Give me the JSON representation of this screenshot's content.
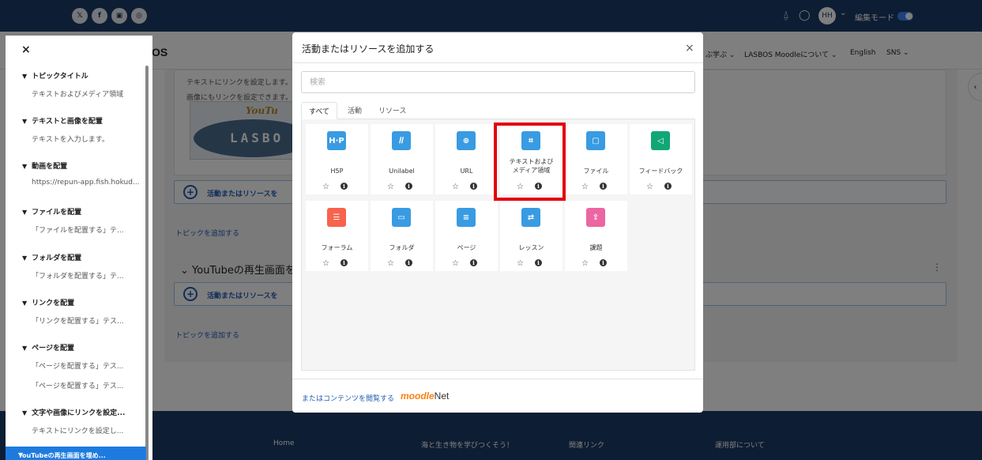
{
  "topbar": {
    "social": [
      "𝕏",
      "f",
      "▣",
      "◎"
    ],
    "avatar_initials": "HH",
    "edit_mode_label": "編集モード",
    "edit_mode_on": true
  },
  "navbar": {
    "logo_fragment": "OS",
    "items": [
      "ぶ学ぶ ⌄",
      "LASBOS Moodleについて ⌄",
      "English",
      "SNS ⌄"
    ]
  },
  "background": {
    "text1": "テキストにリンクを設定します。",
    "text2": "画像にもリンクを設定できます。",
    "youtube_top": "YouTu",
    "youtube_word": "LASBO",
    "add_activity": "活動またはリソースを",
    "add_topic": "トピックを追加する",
    "section_title": "YouTubeの再生画面を",
    "section_chevron": "⌄",
    "kebab": "⋮",
    "right_handle": "‹"
  },
  "footer": {
    "items": [
      "Home",
      "海と生き物を学びつくそう！",
      "関連リンク",
      "運用部について"
    ]
  },
  "drawer": {
    "close": "×",
    "sections": [
      {
        "title": "トピックタイトル",
        "items": [
          "テキストおよびメディア領域"
        ]
      },
      {
        "title": "テキストと画像を配置",
        "items": [
          "テキストを入力します。"
        ]
      },
      {
        "title": "動画を配置",
        "items": [
          "https://repun-app.fish.hokud..."
        ]
      },
      {
        "title": "ファイルを配置",
        "items": [
          "「ファイルを配置する」テ..."
        ]
      },
      {
        "title": "フォルダを配置",
        "items": [
          "「フォルダを配置する」テ..."
        ]
      },
      {
        "title": "リンクを配置",
        "items": [
          "「リンクを配置する」テス..."
        ]
      },
      {
        "title": "ページを配置",
        "items": [
          "「ページを配置する」テス...",
          "「ページを配置する」テス..."
        ]
      },
      {
        "title": "文字や画像にリンクを設定...",
        "items": [
          "テキストにリンクを設定し..."
        ]
      }
    ],
    "active": "YouTubeの再生画面を埋め..."
  },
  "modal": {
    "title": "活動またはリソースを追加する",
    "close": "×",
    "search_placeholder": "検索",
    "tabs": [
      "すべて",
      "活動",
      "リソース"
    ],
    "active_tab": "すべて",
    "tiles": [
      {
        "name": "H5P",
        "icon": "h5p-icon",
        "glyph": "H·P",
        "color": "#399be2"
      },
      {
        "name": "Unilabel",
        "icon": "unilabel-icon",
        "glyph": "𝐼𝐼",
        "color": "#399be2"
      },
      {
        "name": "URL",
        "icon": "globe-icon",
        "glyph": "⊕",
        "color": "#399be2"
      },
      {
        "name": "テキストおよび\nメディア領域",
        "icon": "text-media-icon",
        "glyph": "⌗",
        "color": "#399be2"
      },
      {
        "name": "ファイル",
        "icon": "file-icon",
        "glyph": "▢",
        "color": "#399be2"
      },
      {
        "name": "フィードバック",
        "icon": "megaphone-icon",
        "glyph": "◁",
        "color": "#11a676"
      },
      {
        "name": "フォーラム",
        "icon": "forum-icon",
        "glyph": "☰",
        "color": "#f7634d"
      },
      {
        "name": "フォルダ",
        "icon": "folder-icon",
        "glyph": "▭",
        "color": "#399be2"
      },
      {
        "name": "ページ",
        "icon": "page-icon",
        "glyph": "≡",
        "color": "#399be2"
      },
      {
        "name": "レッスン",
        "icon": "lesson-icon",
        "glyph": "⇄",
        "color": "#399be2"
      },
      {
        "name": "課題",
        "icon": "assignment-icon",
        "glyph": "⇪",
        "color": "#eb66a2"
      }
    ],
    "star": "☆",
    "info": "i",
    "highlighted_tile": "テキストおよび\nメディア領域",
    "footer_link": "またはコンテンツを閲覧する",
    "moodlenet_a": "moodle",
    "moodlenet_b": "Net"
  }
}
